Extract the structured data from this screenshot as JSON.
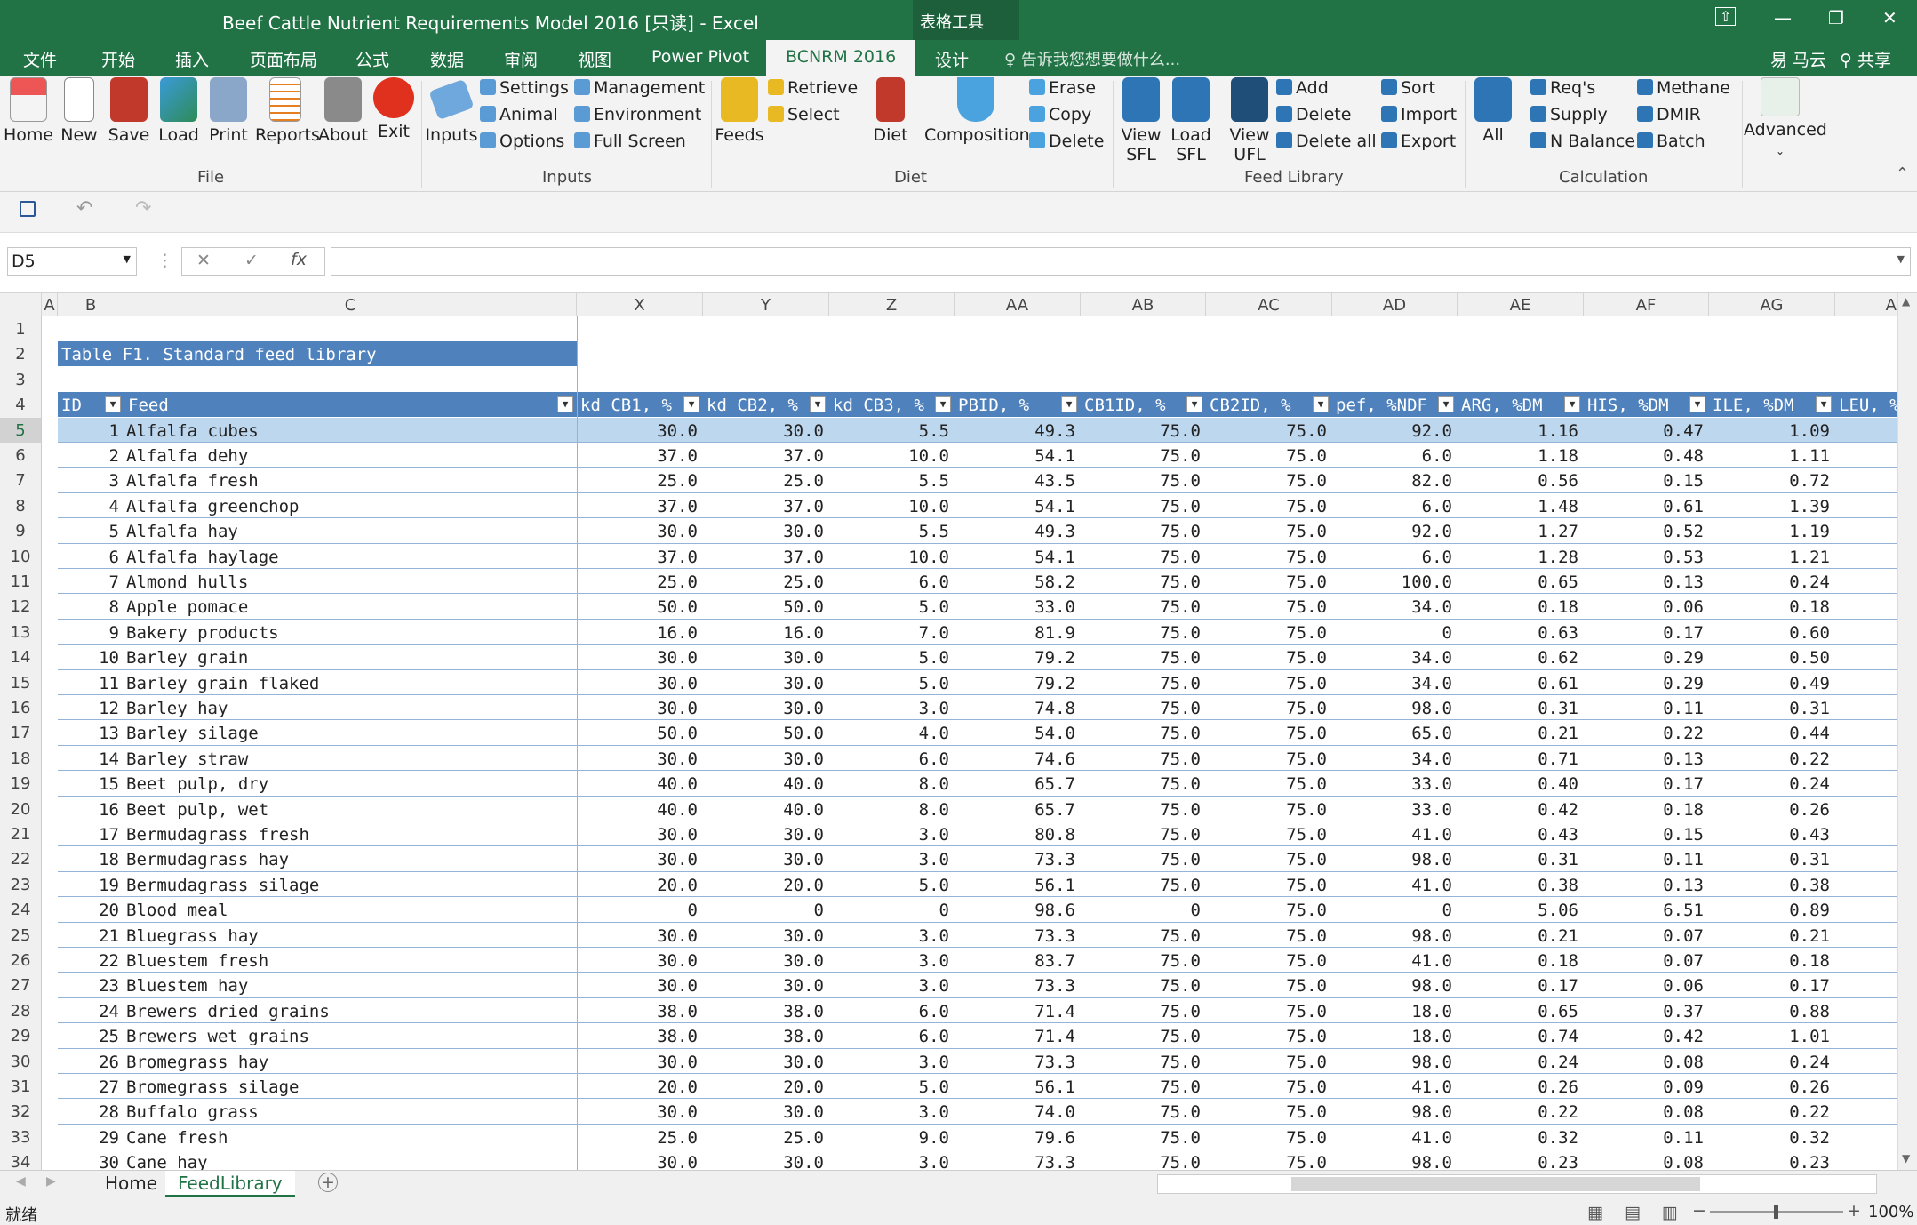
{
  "window": {
    "title": "Beef Cattle Nutrient Requirements Model 2016  [只读] - Excel",
    "tools_label": "表格工具",
    "restore_icon": "restore-icon",
    "min_glyph": "—",
    "max_glyph": "❐",
    "close_glyph": "✕"
  },
  "tabs": [
    {
      "label": "文件"
    },
    {
      "label": "开始"
    },
    {
      "label": "插入"
    },
    {
      "label": "页面布局"
    },
    {
      "label": "公式"
    },
    {
      "label": "数据"
    },
    {
      "label": "审阅"
    },
    {
      "label": "视图"
    },
    {
      "label": "Power Pivot"
    },
    {
      "label": "BCNRM 2016"
    },
    {
      "label": "设计"
    }
  ],
  "tell_me": "告诉我您想要做什么...",
  "user_name": "易 马云",
  "share_label": "共享",
  "ribbon": {
    "file_group": {
      "label": "File",
      "buttons": [
        "Home",
        "New",
        "Save",
        "Load",
        "Print",
        "Reports",
        "About",
        "Exit"
      ]
    },
    "inputs_group": {
      "label": "Inputs",
      "big": "Inputs",
      "small": [
        "Settings",
        "Animal",
        "Options",
        "Management",
        "Environment",
        "Full Screen"
      ]
    },
    "diet_group": {
      "label": "Diet",
      "big": [
        "Feeds",
        "Diet",
        "Composition"
      ],
      "small": [
        "Retrieve",
        "Select",
        "Erase",
        "Copy",
        "Delete"
      ]
    },
    "feedlib_group": {
      "label": "Feed Library",
      "big": [
        "View\nSFL",
        "Load\nSFL",
        "View\nUFL"
      ],
      "small": [
        "Add",
        "Delete",
        "Delete all",
        "Sort",
        "Import",
        "Export"
      ]
    },
    "calc_group": {
      "label": "Calculation",
      "big": [
        "All",
        "Advanced"
      ],
      "small": [
        "Req's",
        "Supply",
        "N Balance",
        "Methane",
        "DMIR",
        "Batch"
      ]
    }
  },
  "name_box": "D5",
  "fx_label": "fx",
  "columns": [
    "A",
    "B",
    "C",
    "X",
    "Y",
    "Z",
    "AA",
    "AB",
    "AC",
    "AD",
    "AE",
    "AF",
    "AG",
    "A"
  ],
  "table_title": "Table F1. Standard feed library",
  "table_headers": [
    "ID",
    "Feed",
    "kd CB1, %",
    "kd CB2, %",
    "kd CB3, %",
    "PBID, %",
    "CB1ID, %",
    "CB2ID, %",
    "pef, %NDF",
    "ARG, %DM",
    "HIS, %DM",
    "ILE, %DM",
    "LEU, %"
  ],
  "rows": [
    [
      "1",
      "Alfalfa cubes",
      "30.0",
      "30.0",
      "5.5",
      "49.3",
      "75.0",
      "75.0",
      "92.0",
      "1.16",
      "0.47",
      "1.09"
    ],
    [
      "2",
      "Alfalfa dehy",
      "37.0",
      "37.0",
      "10.0",
      "54.1",
      "75.0",
      "75.0",
      "6.0",
      "1.18",
      "0.48",
      "1.11"
    ],
    [
      "3",
      "Alfalfa fresh",
      "25.0",
      "25.0",
      "5.5",
      "43.5",
      "75.0",
      "75.0",
      "82.0",
      "0.56",
      "0.15",
      "0.72"
    ],
    [
      "4",
      "Alfalfa greenchop",
      "37.0",
      "37.0",
      "10.0",
      "54.1",
      "75.0",
      "75.0",
      "6.0",
      "1.48",
      "0.61",
      "1.39"
    ],
    [
      "5",
      "Alfalfa hay",
      "30.0",
      "30.0",
      "5.5",
      "49.3",
      "75.0",
      "75.0",
      "92.0",
      "1.27",
      "0.52",
      "1.19"
    ],
    [
      "6",
      "Alfalfa haylage",
      "37.0",
      "37.0",
      "10.0",
      "54.1",
      "75.0",
      "75.0",
      "6.0",
      "1.28",
      "0.53",
      "1.21"
    ],
    [
      "7",
      "Almond hulls",
      "25.0",
      "25.0",
      "6.0",
      "58.2",
      "75.0",
      "75.0",
      "100.0",
      "0.65",
      "0.13",
      "0.24"
    ],
    [
      "8",
      "Apple pomace",
      "50.0",
      "50.0",
      "5.0",
      "33.0",
      "75.0",
      "75.0",
      "34.0",
      "0.18",
      "0.06",
      "0.18"
    ],
    [
      "9",
      "Bakery products",
      "16.0",
      "16.0",
      "7.0",
      "81.9",
      "75.0",
      "75.0",
      "0",
      "0.63",
      "0.17",
      "0.60"
    ],
    [
      "10",
      "Barley grain",
      "30.0",
      "30.0",
      "5.0",
      "79.2",
      "75.0",
      "75.0",
      "34.0",
      "0.62",
      "0.29",
      "0.50"
    ],
    [
      "11",
      "Barley grain flaked",
      "30.0",
      "30.0",
      "5.0",
      "79.2",
      "75.0",
      "75.0",
      "34.0",
      "0.61",
      "0.29",
      "0.49"
    ],
    [
      "12",
      "Barley hay",
      "30.0",
      "30.0",
      "3.0",
      "74.8",
      "75.0",
      "75.0",
      "98.0",
      "0.31",
      "0.11",
      "0.31"
    ],
    [
      "13",
      "Barley silage",
      "50.0",
      "50.0",
      "4.0",
      "54.0",
      "75.0",
      "75.0",
      "65.0",
      "0.21",
      "0.22",
      "0.44"
    ],
    [
      "14",
      "Barley straw",
      "30.0",
      "30.0",
      "6.0",
      "74.6",
      "75.0",
      "75.0",
      "34.0",
      "0.71",
      "0.13",
      "0.22"
    ],
    [
      "15",
      "Beet pulp, dry",
      "40.0",
      "40.0",
      "8.0",
      "65.7",
      "75.0",
      "75.0",
      "33.0",
      "0.40",
      "0.17",
      "0.24"
    ],
    [
      "16",
      "Beet pulp, wet",
      "40.0",
      "40.0",
      "8.0",
      "65.7",
      "75.0",
      "75.0",
      "33.0",
      "0.42",
      "0.18",
      "0.26"
    ],
    [
      "17",
      "Bermudagrass fresh",
      "30.0",
      "30.0",
      "3.0",
      "80.8",
      "75.0",
      "75.0",
      "41.0",
      "0.43",
      "0.15",
      "0.43"
    ],
    [
      "18",
      "Bermudagrass hay",
      "30.0",
      "30.0",
      "3.0",
      "73.3",
      "75.0",
      "75.0",
      "98.0",
      "0.31",
      "0.11",
      "0.31"
    ],
    [
      "19",
      "Bermudagrass silage",
      "20.0",
      "20.0",
      "5.0",
      "56.1",
      "75.0",
      "75.0",
      "41.0",
      "0.38",
      "0.13",
      "0.38"
    ],
    [
      "20",
      "Blood meal",
      "0",
      "0",
      "0",
      "98.6",
      "0",
      "75.0",
      "0",
      "5.06",
      "6.51",
      "0.89"
    ],
    [
      "21",
      "Bluegrass hay",
      "30.0",
      "30.0",
      "3.0",
      "73.3",
      "75.0",
      "75.0",
      "98.0",
      "0.21",
      "0.07",
      "0.21"
    ],
    [
      "22",
      "Bluestem fresh",
      "30.0",
      "30.0",
      "3.0",
      "83.7",
      "75.0",
      "75.0",
      "41.0",
      "0.18",
      "0.07",
      "0.18"
    ],
    [
      "23",
      "Bluestem hay",
      "30.0",
      "30.0",
      "3.0",
      "73.3",
      "75.0",
      "75.0",
      "98.0",
      "0.17",
      "0.06",
      "0.17"
    ],
    [
      "24",
      "Brewers dried grains",
      "38.0",
      "38.0",
      "6.0",
      "71.4",
      "75.0",
      "75.0",
      "18.0",
      "0.65",
      "0.37",
      "0.88"
    ],
    [
      "25",
      "Brewers wet grains",
      "38.0",
      "38.0",
      "6.0",
      "71.4",
      "75.0",
      "75.0",
      "18.0",
      "0.74",
      "0.42",
      "1.01"
    ],
    [
      "26",
      "Bromegrass hay",
      "30.0",
      "30.0",
      "3.0",
      "73.3",
      "75.0",
      "75.0",
      "98.0",
      "0.24",
      "0.08",
      "0.24"
    ],
    [
      "27",
      "Bromegrass silage",
      "20.0",
      "20.0",
      "5.0",
      "56.1",
      "75.0",
      "75.0",
      "41.0",
      "0.26",
      "0.09",
      "0.26"
    ],
    [
      "28",
      "Buffalo grass",
      "30.0",
      "30.0",
      "3.0",
      "74.0",
      "75.0",
      "75.0",
      "98.0",
      "0.22",
      "0.08",
      "0.22"
    ],
    [
      "29",
      "Cane fresh",
      "25.0",
      "25.0",
      "9.0",
      "79.6",
      "75.0",
      "75.0",
      "41.0",
      "0.32",
      "0.11",
      "0.32"
    ],
    [
      "30",
      "Cane hay",
      "30.0",
      "30.0",
      "3.0",
      "73.3",
      "75.0",
      "75.0",
      "98.0",
      "0.23",
      "0.08",
      "0.23"
    ]
  ],
  "sheet_tabs": [
    "Home",
    "FeedLibrary"
  ],
  "status_text": "就绪",
  "zoom": "100%",
  "colors": {
    "excel_green": "#217346",
    "table_header": "#4f81bd",
    "selection": "#bdd7ee"
  }
}
